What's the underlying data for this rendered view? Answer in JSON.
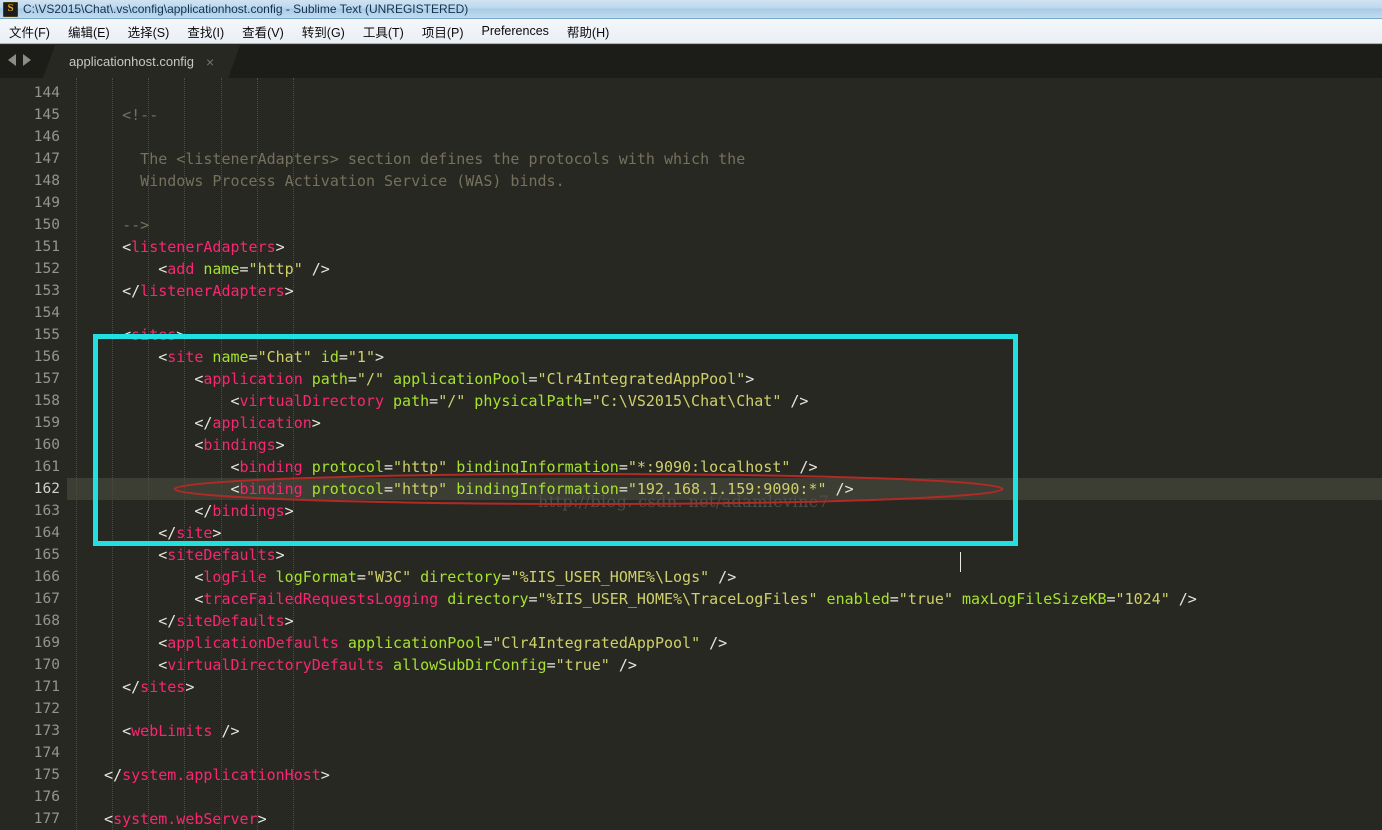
{
  "window": {
    "title": "C:\\VS2015\\Chat\\.vs\\config\\applicationhost.config - Sublime Text (UNREGISTERED)",
    "app_icon": "sublime-text-icon"
  },
  "menubar": {
    "items": [
      {
        "label": "文件(F)"
      },
      {
        "label": "编辑(E)"
      },
      {
        "label": "选择(S)"
      },
      {
        "label": "查找(I)"
      },
      {
        "label": "查看(V)"
      },
      {
        "label": "转到(G)"
      },
      {
        "label": "工具(T)"
      },
      {
        "label": "项目(P)"
      },
      {
        "label": "Preferences"
      },
      {
        "label": "帮助(H)"
      }
    ]
  },
  "tabs": {
    "prev_label": "◀",
    "next_label": "▶",
    "items": [
      {
        "label": "applicationhost.config",
        "close_label": "×",
        "active": true
      }
    ]
  },
  "editor": {
    "first_line": 144,
    "active_line": 162,
    "watermark": "http://blog. csdn. net/adamlevine7",
    "lines": [
      {
        "n": 144,
        "indent": 0,
        "tokens": []
      },
      {
        "n": 145,
        "indent": 4,
        "tokens": [
          {
            "c": "t-com",
            "s": "<!--"
          }
        ]
      },
      {
        "n": 146,
        "indent": 0,
        "tokens": []
      },
      {
        "n": 147,
        "indent": 6,
        "tokens": [
          {
            "c": "t-com",
            "s": "The <listenerAdapters> section defines the protocols with which the"
          }
        ]
      },
      {
        "n": 148,
        "indent": 6,
        "tokens": [
          {
            "c": "t-com",
            "s": "Windows Process Activation Service (WAS) binds."
          }
        ]
      },
      {
        "n": 149,
        "indent": 0,
        "tokens": []
      },
      {
        "n": 150,
        "indent": 4,
        "tokens": [
          {
            "c": "t-com",
            "s": "-->"
          }
        ]
      },
      {
        "n": 151,
        "indent": 4,
        "tokens": [
          {
            "c": "t-punc",
            "s": "<"
          },
          {
            "c": "t-tag",
            "s": "listenerAdapters"
          },
          {
            "c": "t-punc",
            "s": ">"
          }
        ]
      },
      {
        "n": 152,
        "indent": 8,
        "tokens": [
          {
            "c": "t-punc",
            "s": "<"
          },
          {
            "c": "t-tag",
            "s": "add"
          },
          {
            "c": "t-attr",
            "s": " name"
          },
          {
            "c": "t-eq",
            "s": "="
          },
          {
            "c": "t-str",
            "s": "\"http\""
          },
          {
            "c": "t-punc",
            "s": " />"
          }
        ]
      },
      {
        "n": 153,
        "indent": 4,
        "tokens": [
          {
            "c": "t-punc",
            "s": "</"
          },
          {
            "c": "t-tag",
            "s": "listenerAdapters"
          },
          {
            "c": "t-punc",
            "s": ">"
          }
        ]
      },
      {
        "n": 154,
        "indent": 0,
        "tokens": []
      },
      {
        "n": 155,
        "indent": 4,
        "tokens": [
          {
            "c": "t-punc",
            "s": "<"
          },
          {
            "c": "t-tag",
            "s": "sites"
          },
          {
            "c": "t-punc",
            "s": ">"
          }
        ]
      },
      {
        "n": 156,
        "indent": 8,
        "tokens": [
          {
            "c": "t-punc",
            "s": "<"
          },
          {
            "c": "t-tag",
            "s": "site"
          },
          {
            "c": "t-attr",
            "s": " name"
          },
          {
            "c": "t-eq",
            "s": "="
          },
          {
            "c": "t-str",
            "s": "\"Chat\""
          },
          {
            "c": "t-attr",
            "s": " id"
          },
          {
            "c": "t-eq",
            "s": "="
          },
          {
            "c": "t-str",
            "s": "\"1\""
          },
          {
            "c": "t-punc",
            "s": ">"
          }
        ]
      },
      {
        "n": 157,
        "indent": 12,
        "tokens": [
          {
            "c": "t-punc",
            "s": "<"
          },
          {
            "c": "t-tag",
            "s": "application"
          },
          {
            "c": "t-attr",
            "s": " path"
          },
          {
            "c": "t-eq",
            "s": "="
          },
          {
            "c": "t-str",
            "s": "\"/\""
          },
          {
            "c": "t-attr",
            "s": " applicationPool"
          },
          {
            "c": "t-eq",
            "s": "="
          },
          {
            "c": "t-str",
            "s": "\"Clr4IntegratedAppPool\""
          },
          {
            "c": "t-punc",
            "s": ">"
          }
        ]
      },
      {
        "n": 158,
        "indent": 16,
        "tokens": [
          {
            "c": "t-punc",
            "s": "<"
          },
          {
            "c": "t-tag",
            "s": "virtualDirectory"
          },
          {
            "c": "t-attr",
            "s": " path"
          },
          {
            "c": "t-eq",
            "s": "="
          },
          {
            "c": "t-str",
            "s": "\"/\""
          },
          {
            "c": "t-attr",
            "s": " physicalPath"
          },
          {
            "c": "t-eq",
            "s": "="
          },
          {
            "c": "t-str",
            "s": "\"C:\\VS2015\\Chat\\Chat\""
          },
          {
            "c": "t-punc",
            "s": " />"
          }
        ]
      },
      {
        "n": 159,
        "indent": 12,
        "tokens": [
          {
            "c": "t-punc",
            "s": "</"
          },
          {
            "c": "t-tag",
            "s": "application"
          },
          {
            "c": "t-punc",
            "s": ">"
          }
        ]
      },
      {
        "n": 160,
        "indent": 12,
        "tokens": [
          {
            "c": "t-punc",
            "s": "<"
          },
          {
            "c": "t-tag",
            "s": "bindings"
          },
          {
            "c": "t-punc",
            "s": ">"
          }
        ]
      },
      {
        "n": 161,
        "indent": 16,
        "tokens": [
          {
            "c": "t-punc",
            "s": "<"
          },
          {
            "c": "t-tag",
            "s": "binding"
          },
          {
            "c": "t-attr",
            "s": " protocol"
          },
          {
            "c": "t-eq",
            "s": "="
          },
          {
            "c": "t-str",
            "s": "\"http\""
          },
          {
            "c": "t-attr",
            "s": " bindingInformation"
          },
          {
            "c": "t-eq",
            "s": "="
          },
          {
            "c": "t-str",
            "s": "\"*:9090:localhost\""
          },
          {
            "c": "t-punc",
            "s": " />"
          }
        ]
      },
      {
        "n": 162,
        "indent": 16,
        "tokens": [
          {
            "c": "t-punc",
            "s": "<"
          },
          {
            "c": "t-tag",
            "s": "binding"
          },
          {
            "c": "t-attr",
            "s": " protocol"
          },
          {
            "c": "t-eq",
            "s": "="
          },
          {
            "c": "t-str",
            "s": "\"http\""
          },
          {
            "c": "t-attr",
            "s": " bindingInformation"
          },
          {
            "c": "t-eq",
            "s": "="
          },
          {
            "c": "t-str",
            "s": "\"192.168.1.159:9090:*\""
          },
          {
            "c": "t-punc",
            "s": " />"
          }
        ]
      },
      {
        "n": 163,
        "indent": 12,
        "tokens": [
          {
            "c": "t-punc",
            "s": "</"
          },
          {
            "c": "t-tag",
            "s": "bindings"
          },
          {
            "c": "t-punc",
            "s": ">"
          }
        ]
      },
      {
        "n": 164,
        "indent": 8,
        "tokens": [
          {
            "c": "t-punc",
            "s": "</"
          },
          {
            "c": "t-tag",
            "s": "site"
          },
          {
            "c": "t-punc",
            "s": ">"
          }
        ]
      },
      {
        "n": 165,
        "indent": 8,
        "tokens": [
          {
            "c": "t-punc",
            "s": "<"
          },
          {
            "c": "t-tag",
            "s": "siteDefaults"
          },
          {
            "c": "t-punc",
            "s": ">"
          }
        ]
      },
      {
        "n": 166,
        "indent": 12,
        "tokens": [
          {
            "c": "t-punc",
            "s": "<"
          },
          {
            "c": "t-tag",
            "s": "logFile"
          },
          {
            "c": "t-attr",
            "s": " logFormat"
          },
          {
            "c": "t-eq",
            "s": "="
          },
          {
            "c": "t-str",
            "s": "\"W3C\""
          },
          {
            "c": "t-attr",
            "s": " directory"
          },
          {
            "c": "t-eq",
            "s": "="
          },
          {
            "c": "t-str",
            "s": "\"%IIS_USER_HOME%\\Logs\""
          },
          {
            "c": "t-punc",
            "s": " />"
          }
        ]
      },
      {
        "n": 167,
        "indent": 12,
        "tokens": [
          {
            "c": "t-punc",
            "s": "<"
          },
          {
            "c": "t-tag",
            "s": "traceFailedRequestsLogging"
          },
          {
            "c": "t-attr",
            "s": " directory"
          },
          {
            "c": "t-eq",
            "s": "="
          },
          {
            "c": "t-str",
            "s": "\"%IIS_USER_HOME%\\TraceLogFiles\""
          },
          {
            "c": "t-attr",
            "s": " enabled"
          },
          {
            "c": "t-eq",
            "s": "="
          },
          {
            "c": "t-str",
            "s": "\"true\""
          },
          {
            "c": "t-attr",
            "s": " maxLogFileSizeKB"
          },
          {
            "c": "t-eq",
            "s": "="
          },
          {
            "c": "t-str",
            "s": "\"1024\""
          },
          {
            "c": "t-punc",
            "s": " />"
          }
        ]
      },
      {
        "n": 168,
        "indent": 8,
        "tokens": [
          {
            "c": "t-punc",
            "s": "</"
          },
          {
            "c": "t-tag",
            "s": "siteDefaults"
          },
          {
            "c": "t-punc",
            "s": ">"
          }
        ]
      },
      {
        "n": 169,
        "indent": 8,
        "tokens": [
          {
            "c": "t-punc",
            "s": "<"
          },
          {
            "c": "t-tag",
            "s": "applicationDefaults"
          },
          {
            "c": "t-attr",
            "s": " applicationPool"
          },
          {
            "c": "t-eq",
            "s": "="
          },
          {
            "c": "t-str",
            "s": "\"Clr4IntegratedAppPool\""
          },
          {
            "c": "t-punc",
            "s": " />"
          }
        ]
      },
      {
        "n": 170,
        "indent": 8,
        "tokens": [
          {
            "c": "t-punc",
            "s": "<"
          },
          {
            "c": "t-tag",
            "s": "virtualDirectoryDefaults"
          },
          {
            "c": "t-attr",
            "s": " allowSubDirConfig"
          },
          {
            "c": "t-eq",
            "s": "="
          },
          {
            "c": "t-str",
            "s": "\"true\""
          },
          {
            "c": "t-punc",
            "s": " />"
          }
        ]
      },
      {
        "n": 171,
        "indent": 4,
        "tokens": [
          {
            "c": "t-punc",
            "s": "</"
          },
          {
            "c": "t-tag",
            "s": "sites"
          },
          {
            "c": "t-punc",
            "s": ">"
          }
        ]
      },
      {
        "n": 172,
        "indent": 0,
        "tokens": []
      },
      {
        "n": 173,
        "indent": 4,
        "tokens": [
          {
            "c": "t-punc",
            "s": "<"
          },
          {
            "c": "t-tag",
            "s": "webLimits"
          },
          {
            "c": "t-punc",
            "s": " />"
          }
        ]
      },
      {
        "n": 174,
        "indent": 0,
        "tokens": []
      },
      {
        "n": 175,
        "indent": 2,
        "tokens": [
          {
            "c": "t-punc",
            "s": "</"
          },
          {
            "c": "t-tag",
            "s": "system.applicationHost"
          },
          {
            "c": "t-punc",
            "s": ">"
          }
        ]
      },
      {
        "n": 176,
        "indent": 0,
        "tokens": []
      },
      {
        "n": 177,
        "indent": 2,
        "tokens": [
          {
            "c": "t-punc",
            "s": "<"
          },
          {
            "c": "t-tag",
            "s": "system.webServer"
          },
          {
            "c": "t-punc",
            "s": ">"
          }
        ]
      }
    ]
  },
  "annotations": {
    "cyan_box": {
      "color": "#22e0e0",
      "covers_lines": "156-165"
    },
    "red_ellipse": {
      "color": "#b02020",
      "covers_line": 162
    }
  },
  "colors": {
    "editor_background": "#272822",
    "active_line": "#3c3d33",
    "tag": "#f92672",
    "attribute": "#a6e22e",
    "string": "#cfd06a",
    "comment": "#75715e",
    "line_number": "#93958f"
  }
}
